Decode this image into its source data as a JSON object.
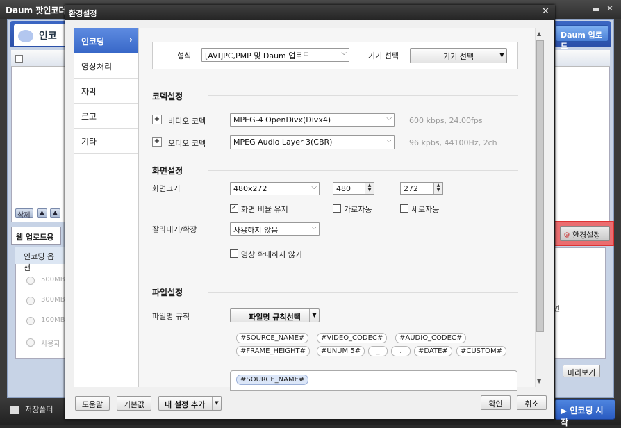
{
  "app": {
    "title": "Daum 팟인코더",
    "tab_encode": "인코",
    "daum_upload": "Daum 업로드",
    "delete_btn": "삭제",
    "web_upload_tab": "웹 업로드용",
    "encode_options_head": "인코딩 옵션",
    "options": [
      "500MB",
      "300MB",
      "100MB",
      "사용자"
    ],
    "preview_btn": "미리보기",
    "side_fragment": "면",
    "env_settings_btn": "환경설정",
    "save_folder": "저장폴더",
    "start_encode": "인코딩 시작",
    "colors": {
      "accent": "#3868c8",
      "highlight": "#f05a5a"
    }
  },
  "dialog": {
    "title": "환경설정",
    "nav": [
      {
        "label": "인코딩",
        "active": true
      },
      {
        "label": "영상처리",
        "active": false
      },
      {
        "label": "자막",
        "active": false
      },
      {
        "label": "로고",
        "active": false
      },
      {
        "label": "기타",
        "active": false
      }
    ],
    "format_label": "형식",
    "format_value": "[AVI]PC,PMP 및 Daum 업로드",
    "device_label": "기기 선택",
    "device_button": "기기 선택",
    "codec_section": "코덱설정",
    "video_codec_label": "비디오 코덱",
    "video_codec_value": "MPEG-4 OpenDivx(Divx4)",
    "video_codec_info": "600 kbps, 24.00fps",
    "audio_codec_label": "오디오 코덱",
    "audio_codec_value": "MPEG Audio Layer 3(CBR)",
    "audio_codec_info": "96 kpbs, 44100Hz, 2ch",
    "screen_section": "화면설정",
    "screen_size_label": "화면크기",
    "screen_size_value": "480x272",
    "width_value": "480",
    "height_value": "272",
    "keep_ratio_label": "화면 비율 유지",
    "keep_ratio_checked": true,
    "auto_width_label": "가로자동",
    "auto_height_label": "세로자동",
    "crop_label": "잘라내기/확장",
    "crop_value": "사용하지 않음",
    "no_upscale_label": "영상 확대하지 않기",
    "file_section": "파일설정",
    "filename_rule_label": "파일명 규칙",
    "filename_rule_button": "파일명 규칙선택",
    "tags_row1": [
      "#SOURCE_NAME#",
      "#VIDEO_CODEC#",
      "#AUDIO_CODEC#"
    ],
    "tags_row2": [
      "#FRAME_HEIGHT#",
      "#UNUM 5#",
      "_",
      ".",
      "#DATE#",
      "#CUSTOM#"
    ],
    "rule_tag": "#SOURCE_NAME#",
    "help_btn": "도움말",
    "default_btn": "기본값",
    "add_preset_btn": "내 설정 추가",
    "ok_btn": "확인",
    "cancel_btn": "취소"
  }
}
